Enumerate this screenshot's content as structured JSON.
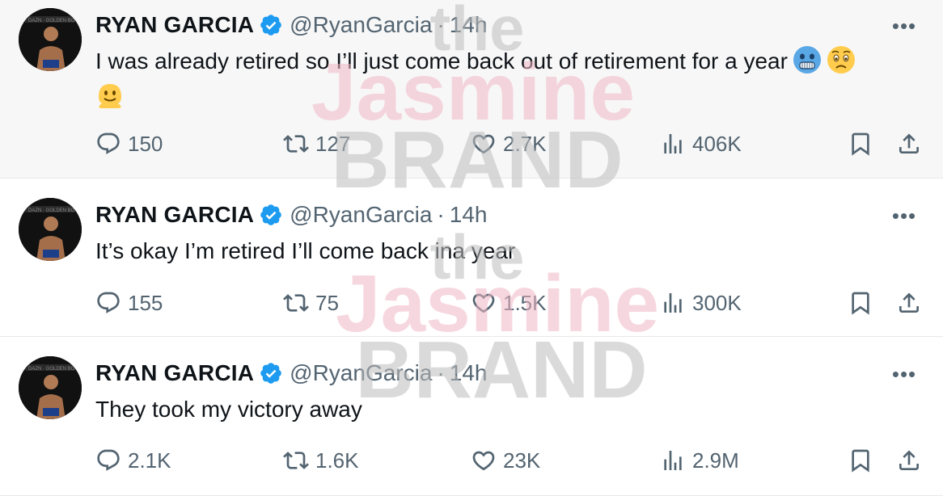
{
  "colors": {
    "text": "#0f1419",
    "muted": "#536471",
    "verified": "#1d9bf0",
    "wm_pink": "#f2b8c6",
    "wm_gray": "#bdbdbd"
  },
  "watermark": {
    "line1": "the",
    "line2": "Jasmine",
    "line3": "BRAND"
  },
  "tweets": [
    {
      "name": "RYAN GARCIA",
      "handle": "@RyanGarcia",
      "dot": "·",
      "time": "14h",
      "more": "•••",
      "text": "I was already retired so I’ll just come back out of retirement for a year",
      "emojis": [
        "cold-face-emoji",
        "anxious-face-emoji",
        "melting-face-emoji"
      ],
      "replies": "150",
      "retweets": "127",
      "likes": "2.7K",
      "views": "406K"
    },
    {
      "name": "RYAN GARCIA",
      "handle": "@RyanGarcia",
      "dot": "·",
      "time": "14h",
      "more": "•••",
      "text": "It’s okay I’m retired I’ll come back ina year",
      "replies": "155",
      "retweets": "75",
      "likes": "1.5K",
      "views": "300K"
    },
    {
      "name": "RYAN GARCIA",
      "handle": "@RyanGarcia",
      "dot": "·",
      "time": "14h",
      "more": "•••",
      "text": "They took my victory away",
      "replies": "2.1K",
      "retweets": "1.6K",
      "likes": "23K",
      "views": "2.9M"
    }
  ]
}
